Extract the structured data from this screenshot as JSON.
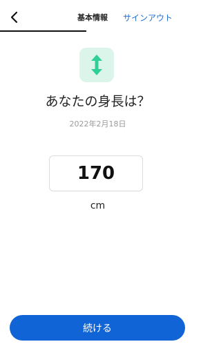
{
  "header": {
    "title": "基本情報",
    "signout_label": "サインアウト",
    "progress": 0.44,
    "back_icon": "chevron-left-icon"
  },
  "question": {
    "icon": "vertical-arrows-icon",
    "icon_color": "#2fcf9a",
    "icon_bg": "#dcf5ea",
    "title": "あなたの身長は？",
    "date": "2022年2月18日"
  },
  "height": {
    "value": "170",
    "unit": "cm"
  },
  "footer": {
    "continue_label": "続ける",
    "accent": "#1064d6"
  }
}
